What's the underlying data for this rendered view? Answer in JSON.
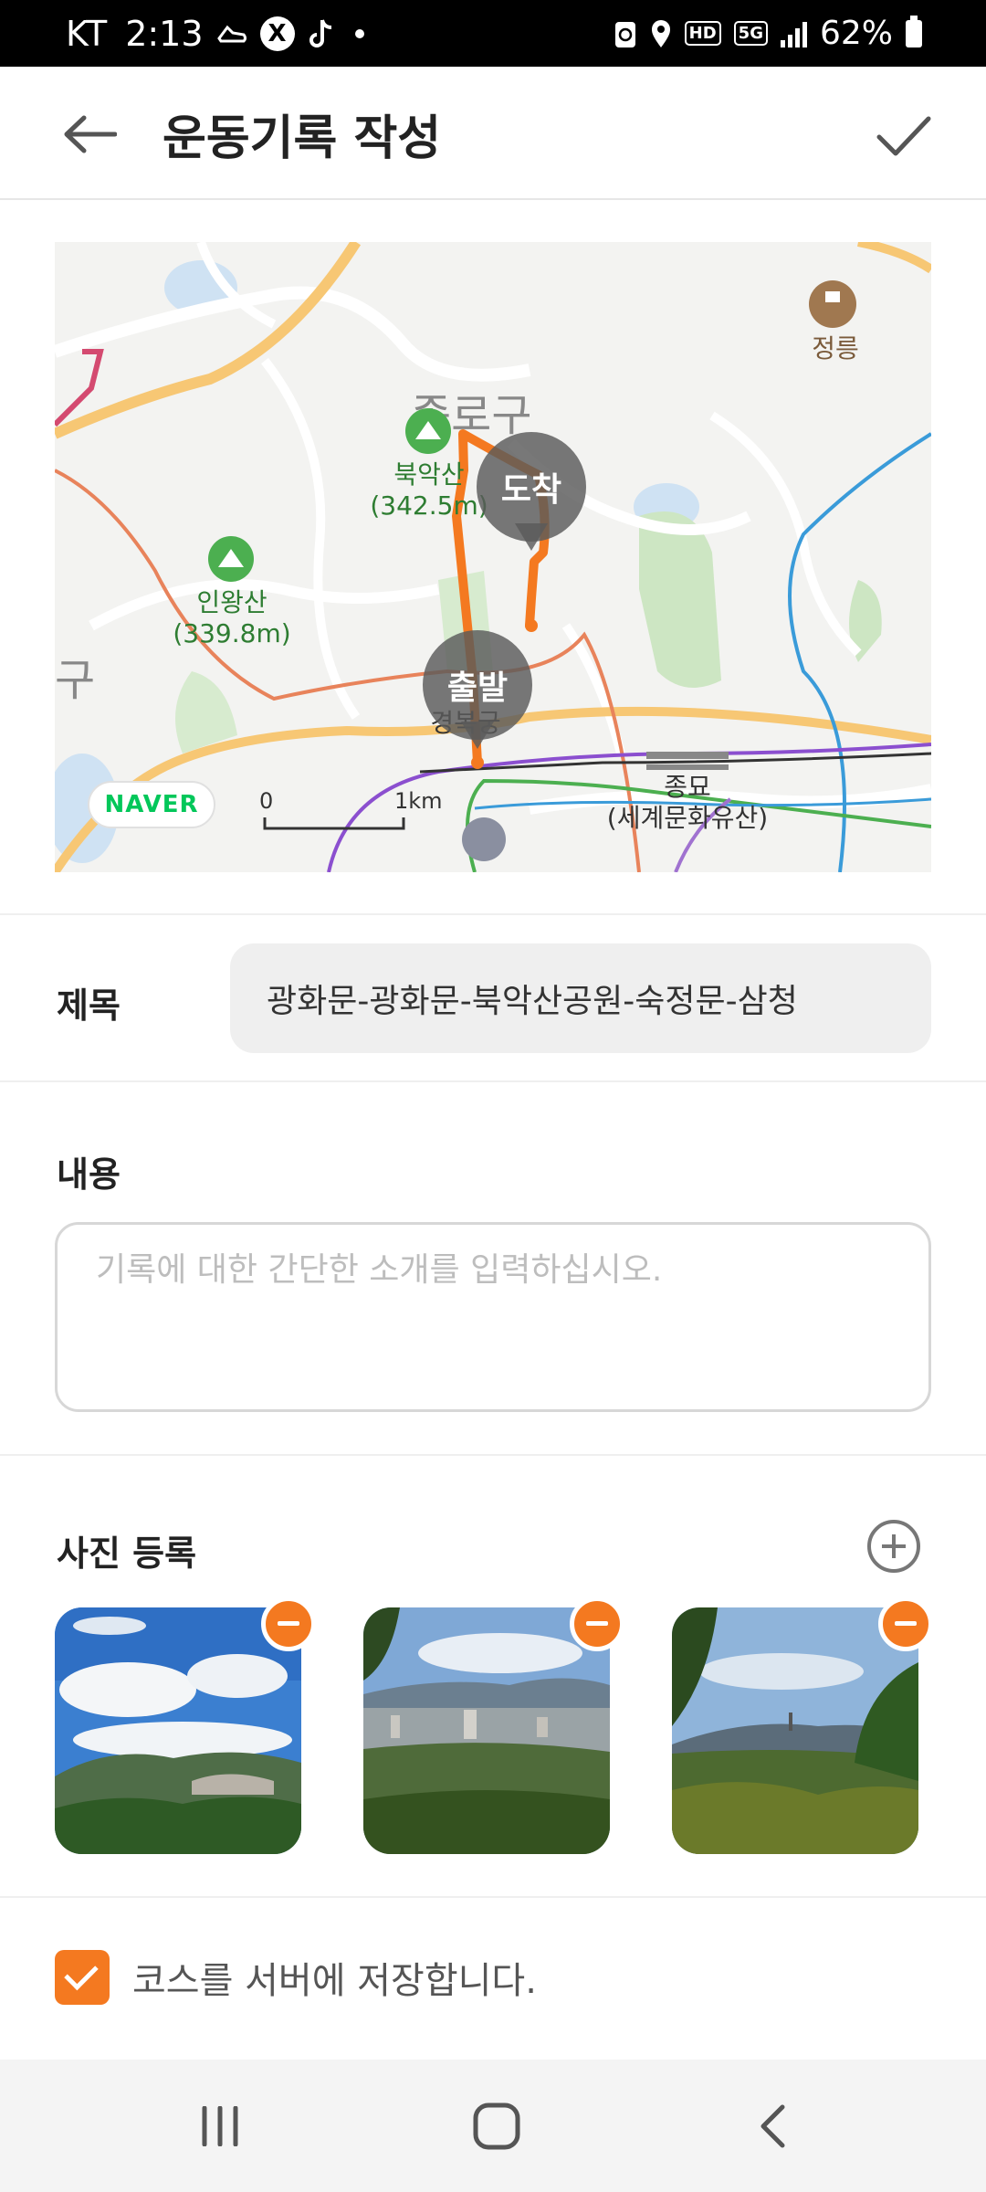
{
  "status_bar": {
    "carrier": "KT",
    "time": "2:13",
    "battery": "62%",
    "hd_badge": "HD",
    "network_badge": "5G"
  },
  "header": {
    "title": "운동기록 작성",
    "back_icon": "arrow-left-icon",
    "confirm_icon": "checkmark-icon"
  },
  "map": {
    "district_labels": [
      "종로구",
      "구"
    ],
    "places": [
      {
        "name": "북악산",
        "elevation": "(342.5m)"
      },
      {
        "name": "인왕산",
        "elevation": "(339.8m)"
      },
      {
        "name": "정릉",
        "elevation": ""
      },
      {
        "name": "경복궁",
        "elevation": ""
      },
      {
        "name": "종묘",
        "elevation": "(세계문화유산)"
      }
    ],
    "markers": {
      "start": "출발",
      "end": "도착"
    },
    "logo": "NAVER",
    "scale": {
      "start": "0",
      "end": "1km"
    },
    "route_color": "#f47920"
  },
  "form": {
    "title_label": "제목",
    "title_value": "광화문-광화문-북악산공원-숙정문-삼청",
    "content_label": "내용",
    "content_placeholder": "기록에 대한 간단한 소개를 입력하십시오.",
    "photos_label": "사진 등록",
    "add_photo_icon": "plus-circle-icon",
    "photos": [
      {
        "name": "photo-clouds-mountain",
        "remove_icon": "minus-circle-icon"
      },
      {
        "name": "photo-city-view",
        "remove_icon": "minus-circle-icon"
      },
      {
        "name": "photo-forest-view",
        "remove_icon": "minus-circle-icon"
      }
    ],
    "save_course_label": "코스를 서버에 저장합니다.",
    "save_course_checked": true
  },
  "nav_bar": {
    "recents_icon": "recents-icon",
    "home_icon": "home-icon",
    "back_icon": "back-chevron-icon"
  },
  "colors": {
    "accent": "#f47920",
    "input_bg": "#efefef"
  }
}
